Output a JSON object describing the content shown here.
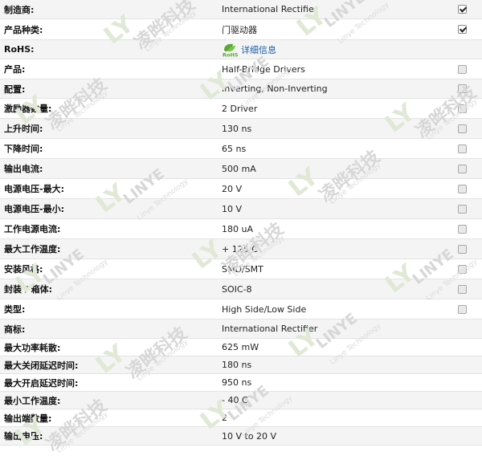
{
  "rows": [
    {
      "label": "制造商:",
      "value": "International Rectifier",
      "checkbox": "checked"
    },
    {
      "label": "产品种类:",
      "value": "门驱动器",
      "checkbox": "checked"
    },
    {
      "label": "RoHS:",
      "value": "详细信息",
      "checkbox": "none",
      "logo_text": "RoHS"
    },
    {
      "label": "产品:",
      "value": "Half-Bridge Drivers",
      "checkbox": "unchecked"
    },
    {
      "label": "配置:",
      "value": "Inverting, Non-Inverting",
      "checkbox": "unchecked"
    },
    {
      "label": "激励器数量:",
      "value": "2 Driver",
      "checkbox": "unchecked"
    },
    {
      "label": "上升时间:",
      "value": "130 ns",
      "checkbox": "unchecked"
    },
    {
      "label": "下降时间:",
      "value": "65 ns",
      "checkbox": "unchecked"
    },
    {
      "label": "输出电流:",
      "value": "500 mA",
      "checkbox": "unchecked"
    },
    {
      "label": "电源电压-最大:",
      "value": "20 V",
      "checkbox": "unchecked"
    },
    {
      "label": "电源电压-最小:",
      "value": "10 V",
      "checkbox": "unchecked"
    },
    {
      "label": "工作电源电流:",
      "value": "180 uA",
      "checkbox": "unchecked"
    },
    {
      "label": "最大工作温度:",
      "value": "+ 125 C",
      "checkbox": "unchecked"
    },
    {
      "label": "安装风格:",
      "value": "SMD/SMT",
      "checkbox": "unchecked"
    },
    {
      "label": "封装 / 箱体:",
      "value": "SOIC-8",
      "checkbox": "unchecked"
    },
    {
      "label": "类型:",
      "value": "High Side/Low Side",
      "checkbox": "unchecked"
    },
    {
      "label": "商标:",
      "value": "International Rectifier",
      "checkbox": "none"
    },
    {
      "label": "最大功率耗散:",
      "value": "625 mW",
      "checkbox": "none"
    },
    {
      "label": "最大关闭延迟时间:",
      "value": "180 ns",
      "checkbox": "none"
    },
    {
      "label": "最大开启延迟时间:",
      "value": "950 ns",
      "checkbox": "none"
    },
    {
      "label": "最小工作温度:",
      "value": "- 40 C",
      "checkbox": "none"
    },
    {
      "label": "输出端数量:",
      "value": "2",
      "checkbox": "none"
    },
    {
      "label": "输出电压:",
      "value": "10 V to 20 V",
      "checkbox": "none"
    }
  ],
  "watermark": {
    "brand": "凌晔科技",
    "en": "LINYE",
    "sub": "Linye Technology",
    "logo": "LY"
  },
  "colors": {
    "rohs_green": "#5aa832",
    "link": "#1a5ea8"
  }
}
